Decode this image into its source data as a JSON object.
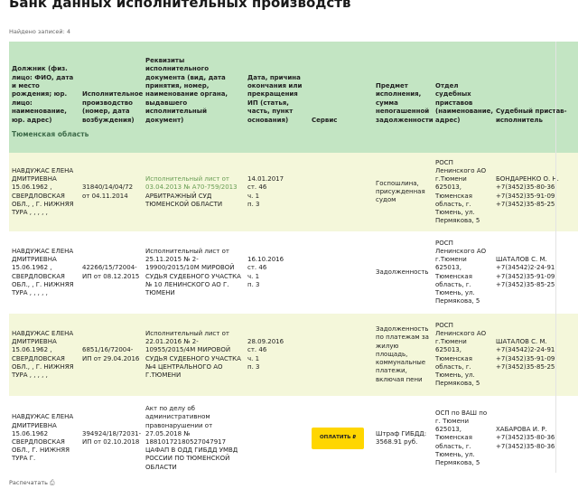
{
  "page": {
    "title": "Банк данных исполнительных производств",
    "found": "Найдено записей: 4",
    "print_label": "Распечатать",
    "print_icon": "printer-icon"
  },
  "table": {
    "columns": [
      "Должник (физ. лицо: ФИО, дата и место рождения; юр. лицо: наименование, юр. адрес)",
      "Исполнительное производство (номер, дата возбуждения)",
      "Реквизиты исполнительного документа (вид, дата принятия, номер, наименование органа, выдавшего исполнительный документ)",
      "Дата, причина окончания или прекращения ИП (статья, часть, пункт основания)",
      "Сервис",
      "Предмет исполнения, сумма непогашенной задолженности",
      "Отдел судебных приставов (наименование, адрес)",
      "Судебный пристав-исполнитель"
    ],
    "region": "Тюменская область",
    "pay_button": "ОПЛАТИТЬ ₽",
    "rows": [
      {
        "debtor": "НАВДУЖАС ЕЛЕНА ДМИТРИЕВНА 15.06.1962 , СВЕРДЛОВСКАЯ ОБЛ., , Г. НИЖНЯЯ ТУРА , , , , ,",
        "ip": "31840/14/04/72 от 04.11.2014",
        "doc_link": "Исполнительный лист от 03.04.2013 № А70-759/2013",
        "doc_rest": "АРБИТРАЖНЫЙ СУД ТЮМЕНСКОЙ ОБЛАСТИ",
        "end_date": "14.01.2017",
        "end_art": "ст. 46",
        "end_part": "ч. 1",
        "end_point": "п. 3",
        "subject": "Госпошлина, присужденная судом",
        "osp": "РОСП Ленинского АО г.Тюмени 625013, Тюменская область, г. Тюмень, ул. Пермякова, 5",
        "bailiff": "БОНДАРЕНКО О. Н. +7(3452)35-80-36 +7(3452)35-91-09 +7(3452)35-85-25",
        "has_pay": false
      },
      {
        "debtor": "НАВДУЖАС ЕЛЕНА ДМИТРИЕВНА 15.06.1962 , СВЕРДЛОВСКАЯ ОБЛ., , Г. НИЖНЯЯ ТУРА , , , , ,",
        "ip": "42266/15/72004-ИП от 08.12.2015",
        "doc_link": "",
        "doc_rest": "Исполнительный лист от 25.11.2015 № 2-19900/2015/10М МИРОВОЙ СУДЬЯ СУДЕБНОГО УЧАСТКА № 10 ЛЕНИНСКОГО АО Г. ТЮМЕНИ",
        "end_date": "16.10.2016",
        "end_art": "ст. 46",
        "end_part": "ч. 1",
        "end_point": "п. 3",
        "subject": "Задолженность",
        "osp": "РОСП Ленинского АО г.Тюмени 625013, Тюменская область, г. Тюмень, ул. Пермякова, 5",
        "bailiff": "ШАТАЛОВ С. М. +7(34542)2-24-91 +7(3452)35-91-09 +7(3452)35-85-25",
        "has_pay": false
      },
      {
        "debtor": "НАВДУЖАС ЕЛЕНА ДМИТРИЕВНА 15.06.1962 , СВЕРДЛОВСКАЯ ОБЛ., , Г. НИЖНЯЯ ТУРА , , , , ,",
        "ip": "6851/16/72004-ИП от 29.04.2016",
        "doc_link": "",
        "doc_rest": "Исполнительный лист от 22.01.2016 № 2-10955/2015/4М МИРОВОЙ СУДЬЯ СУДЕБНОГО УЧАСТКА №4 ЦЕНТРАЛЬНОГО АО Г.ТЮМЕНИ",
        "end_date": "28.09.2016",
        "end_art": "ст. 46",
        "end_part": "ч. 1",
        "end_point": "п. 3",
        "subject": "Задолженность по платежам за жилую площадь, коммунальные платежи, включая пени",
        "osp": "РОСП Ленинского АО г.Тюмени 625013, Тюменская область, г. Тюмень, ул. Пермякова, 5",
        "bailiff": "ШАТАЛОВ С. М. +7(34542)2-24-91 +7(3452)35-91-09 +7(3452)35-85-25",
        "has_pay": false
      },
      {
        "debtor": "НАВДУЖАС ЕЛЕНА ДМИТРИЕВНА 15.06.1962 СВЕРДЛОВСКАЯ ОБЛ., Г. НИЖНЯЯ ТУРА Г.",
        "ip": "394924/18/72031-ИП от 02.10.2018",
        "doc_link": "",
        "doc_rest": "Акт по делу об административном правонарушении от 27.05.2018 № 18810172180527047917 ЦАФАП В ОДД ГИБДД УМВД РОССИИ ПО ТЮМЕНСКОЙ ОБЛАСТИ",
        "end_date": "",
        "end_art": "",
        "end_part": "",
        "end_point": "",
        "subject": "Штраф ГИБДД: 3568.91 руб.",
        "osp": "ОСП по ВАШ по г. Тюмени 625013, Тюменская область, г. Тюмень, ул. Пермякова, 5",
        "bailiff": "ХАБАРОВА И. Р. +7(3452)35-80-36 +7(3452)35-80-36",
        "has_pay": true
      }
    ]
  }
}
